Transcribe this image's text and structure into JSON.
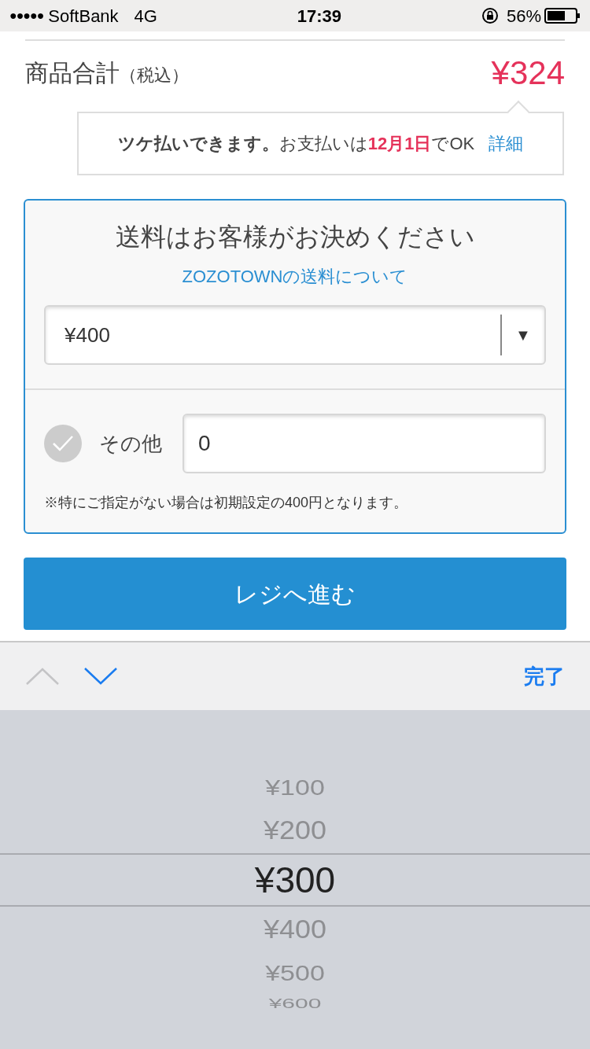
{
  "status_bar": {
    "signal_dots": "●●●●●",
    "carrier": "SoftBank",
    "network": "4G",
    "time": "17:39",
    "battery": "56%"
  },
  "total": {
    "label": "商品合計",
    "tax_note": "（税込）",
    "price": "¥324"
  },
  "pay_later": {
    "headline": "ツケ払いできます。",
    "text": "お支払いは**12月1日**でOK",
    "link": "詳細"
  },
  "shipping": {
    "title": "送料はお客様がお決めください",
    "link": "ZOZOTOWNの送料について",
    "select_value": "¥400",
    "select_arrow": "▼",
    "other_label": "その他",
    "other_checked": false,
    "other_value": "0",
    "note": "※特にご指定がない場合は初期設定の400円となります。"
  },
  "checkout_button": "レジへ進む",
  "keyboard_toolbar": {
    "prev_disabled": true,
    "next_disabled": false,
    "done": "完了"
  },
  "picker": [
    {
      "label": "¥100",
      "selected": false
    },
    {
      "label": "¥200",
      "selected": false
    },
    {
      "label": "¥300",
      "selected": true
    },
    {
      "label": "¥400",
      "selected": false
    },
    {
      "label": "¥500",
      "selected": false
    },
    {
      "label": "¥600",
      "selected": false
    }
  ]
}
